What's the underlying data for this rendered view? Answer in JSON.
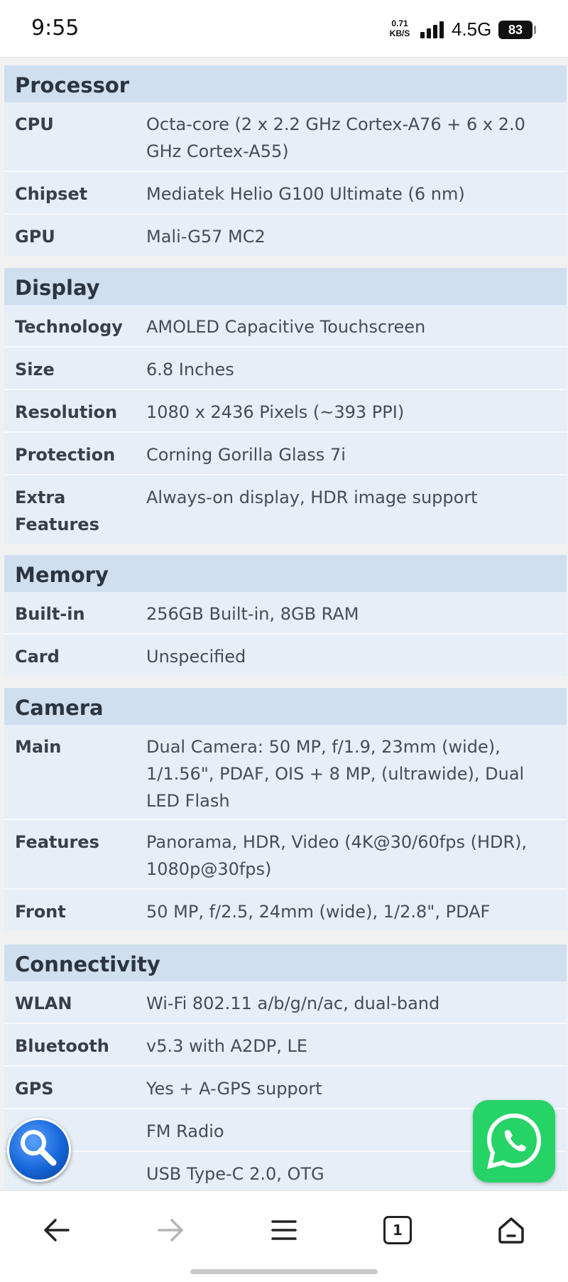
{
  "status_bar": {
    "time": "9:55",
    "net_speed_value": "0.71",
    "net_speed_unit": "KB/S",
    "network_type": "4.5G",
    "battery": "83"
  },
  "sections": [
    {
      "title": "Processor",
      "rows": [
        {
          "label": "CPU",
          "value": "Octa-core (2 x 2.2 GHz Cortex-A76 + 6 x 2.0 GHz Cortex-A55)"
        },
        {
          "label": "Chipset",
          "value": "Mediatek Helio G100 Ultimate (6 nm)"
        },
        {
          "label": "GPU",
          "value": "Mali-G57 MC2"
        }
      ]
    },
    {
      "title": "Display",
      "rows": [
        {
          "label": "Technology",
          "value": "AMOLED Capacitive Touchscreen"
        },
        {
          "label": "Size",
          "value": "6.8 Inches"
        },
        {
          "label": "Resolution",
          "value": "1080 x 2436 Pixels (~393 PPI)"
        },
        {
          "label": "Protection",
          "value": "Corning Gorilla Glass 7i"
        },
        {
          "label": "Extra Features",
          "value": "Always-on display, HDR image support"
        }
      ]
    },
    {
      "title": "Memory",
      "rows": [
        {
          "label": "Built-in",
          "value": "256GB Built-in, 8GB RAM"
        },
        {
          "label": "Card",
          "value": "Unspecified"
        }
      ]
    },
    {
      "title": "Camera",
      "rows": [
        {
          "label": "Main",
          "value": "Dual Camera: 50 MP, f/1.9, 23mm (wide), 1/1.56\", PDAF, OIS + 8 MP, (ultrawide), Dual LED Flash"
        },
        {
          "label": "Features",
          "value": "Panorama, HDR, Video (4K@30/60fps (HDR), 1080p@30fps)"
        },
        {
          "label": "Front",
          "value": "50 MP, f/2.5, 24mm (wide), 1/2.8\", PDAF"
        }
      ]
    },
    {
      "title": "Connectivity",
      "rows": [
        {
          "label": "WLAN",
          "value": "Wi-Fi 802.11 a/b/g/n/ac, dual-band"
        },
        {
          "label": "Bluetooth",
          "value": "v5.3 with A2DP, LE"
        },
        {
          "label": "GPS",
          "value": "Yes + A-GPS support"
        },
        {
          "label": "",
          "value": "FM Radio"
        },
        {
          "label": "",
          "value": "USB Type-C 2.0, OTG"
        }
      ]
    }
  ],
  "bottom_nav": {
    "tab_count": "1",
    "icons": [
      "back-arrow-icon",
      "forward-arrow-icon",
      "menu-icon",
      "tabs-icon",
      "home-icon"
    ]
  },
  "colors": {
    "section_header_bg": "#cfdff0",
    "row_bg": "#e6eef7",
    "whatsapp_green": "#25d366",
    "search_blue": "#1565d8"
  }
}
